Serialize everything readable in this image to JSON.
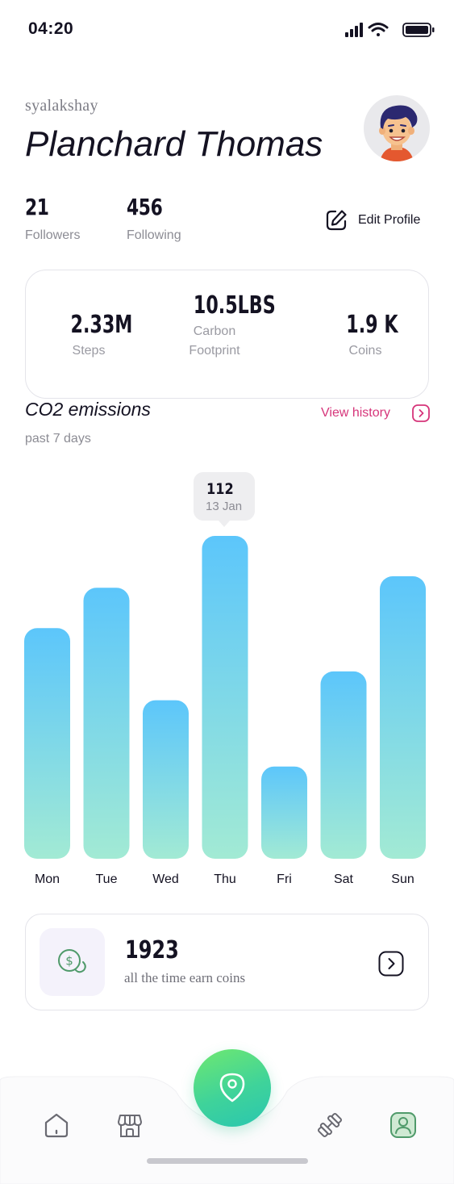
{
  "status_bar": {
    "time": "04:20"
  },
  "profile": {
    "username": "syalakshay",
    "full_name": "Planchard Thomas",
    "followers_count": "21",
    "followers_label": "Followers",
    "following_count": "456",
    "following_label": "Following",
    "edit_label": "Edit Profile"
  },
  "summary": [
    {
      "value": "2.33M",
      "label": "Steps"
    },
    {
      "value": "10.5LBS",
      "label_line1": "Carbon",
      "label_line2": "Footprint"
    },
    {
      "value": "1.9 K",
      "label": "Coins"
    }
  ],
  "emissions": {
    "title": "CO2 emissions",
    "subtitle": "past 7 days",
    "view_history": "View history",
    "tooltip": {
      "value": "112",
      "date": "13 Jan"
    }
  },
  "chart_data": {
    "type": "bar",
    "categories": [
      "Mon",
      "Tue",
      "Wed",
      "Thu",
      "Fri",
      "Sat",
      "Sun"
    ],
    "values": [
      80,
      94,
      55,
      112,
      32,
      65,
      98
    ],
    "ylim": [
      0,
      112
    ],
    "highlight_index": 3,
    "grid": false,
    "colors": {
      "top": "#5cc6fb",
      "bottom": "#a2ead4"
    }
  },
  "coins": {
    "value": "1923",
    "label": "all the time earn coins"
  },
  "nav": {
    "items": [
      "home-icon",
      "store-icon",
      "location-pin-icon",
      "dumbbell-icon",
      "profile-icon"
    ],
    "active": "profile-icon"
  },
  "colors": {
    "accent_pink": "#d6357a",
    "accent_green": "#3fd39a",
    "text_dark": "#141222",
    "text_muted": "#8c8c94"
  }
}
